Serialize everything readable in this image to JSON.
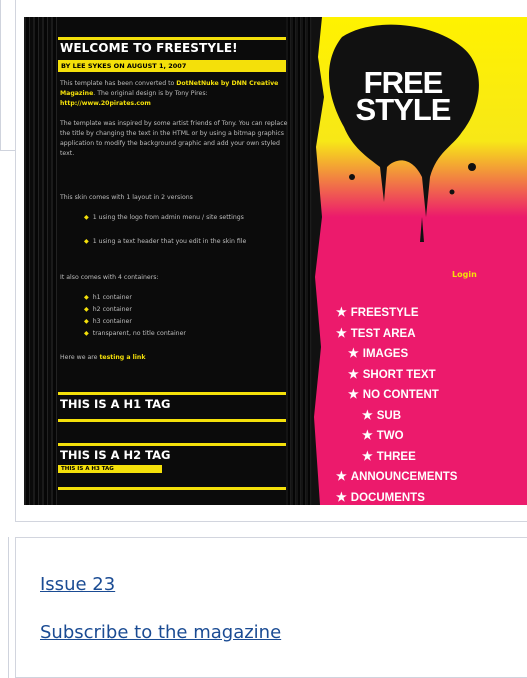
{
  "screenshot": {
    "title": "WELCOME TO FREESTYLE!",
    "byline": "BY LEE SYKES ON AUGUST 1, 2007",
    "para1_a": "This template has been converted to ",
    "para1_b": "DotNetNuke by DNN Creative Magazine",
    "para1_c": ". The original design is by Tony Pires: ",
    "para1_d": "http://www.20pirates.com",
    "para2": "The template was inspired by some artist friends of Tony. You can replace the title by changing the text in the HTML or by using a bitmap graphics application to modify the background graphic and add your own styled text.",
    "para3": "This skin comes with 1 layout in 2 versions",
    "bullets1": [
      "1 using the logo from admin menu / site settings",
      "1 using a text header that you edit in the skin file"
    ],
    "para4": "It also comes with 4 containers:",
    "bullets2": [
      "h1 container",
      "h2 container",
      "h3 container",
      "transparent, no title container"
    ],
    "para5_a": "Here we are ",
    "para5_b": "testing a link",
    "h1": "THIS IS A H1 TAG",
    "h2": "THIS IS A H2 TAG",
    "h3": "THIS IS A H3 TAG",
    "logo": "FREE STYLE",
    "login": "Login",
    "nav": [
      {
        "label": "FREESTYLE",
        "level": 0
      },
      {
        "label": "TEST AREA",
        "level": 0
      },
      {
        "label": "IMAGES",
        "level": 1
      },
      {
        "label": "SHORT TEXT",
        "level": 1
      },
      {
        "label": "NO CONTENT",
        "level": 1
      },
      {
        "label": "SUB",
        "level": 2
      },
      {
        "label": "TWO",
        "level": 2
      },
      {
        "label": "THREE",
        "level": 2
      },
      {
        "label": "ANNOUNCEMENTS",
        "level": 0
      },
      {
        "label": "DOCUMENTS",
        "level": 0
      }
    ],
    "colors": {
      "accent_yellow": "#f4e00a",
      "pink": "#ec1a6c",
      "black": "#0b0b0b"
    }
  },
  "links": {
    "issue": "Issue 23",
    "subscribe": "Subscribe to the magazine",
    "link_color": "#1a4b93"
  }
}
